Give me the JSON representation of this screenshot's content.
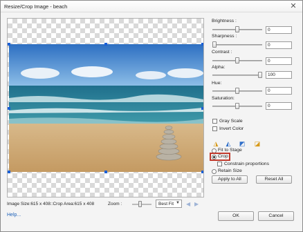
{
  "window": {
    "title": "Resize/Crop Image - beach",
    "close_glyph": "✕"
  },
  "status": {
    "image_size": "Image Size:615 x 408::Crop Area:615 x 408"
  },
  "zoom": {
    "label": "Zoom :",
    "value": "Best Fit",
    "options": [
      "Best Fit"
    ]
  },
  "adjustments": [
    {
      "label": "Brightness :",
      "value": "0",
      "level": 0.5
    },
    {
      "label": "Sharpness :",
      "value": "0",
      "level": 0.0
    },
    {
      "label": "Contrast :",
      "value": "0",
      "level": 0.5
    },
    {
      "label": "Alpha:",
      "value": "100",
      "level": 1.0
    },
    {
      "label": "Hue:",
      "value": "0",
      "level": 0.5
    },
    {
      "label": "Saturation:",
      "value": "0",
      "level": 0.5
    }
  ],
  "options": {
    "gray_scale": "Gray Scale",
    "invert_color": "Invert Color",
    "fit_to_stage": "Fit to Stage",
    "crop": "Crop",
    "constrain_proportions": "Constrain proportions",
    "retain_size": "Retain Size",
    "selected_mode": "Crop"
  },
  "tools": [
    {
      "name": "flip-horizontal-icon",
      "glyph": "◮",
      "color": "#d79a1a"
    },
    {
      "name": "flip-vertical-icon",
      "glyph": "◭",
      "color": "#2f6fc9"
    },
    {
      "name": "rotate-left-icon",
      "glyph": "◩",
      "color": "#2f6fc9"
    },
    {
      "name": "rotate-right-icon",
      "glyph": "◪",
      "color": "#d79a1a"
    }
  ],
  "buttons": {
    "apply_all": "Apply to All",
    "reset_all": "Reset All",
    "ok": "OK",
    "cancel": "Cancel"
  },
  "help": "Help...",
  "colors": {
    "selection_handle": "#1a5fd6",
    "crop_highlight": "#c0392b",
    "link": "#1b5fb8"
  }
}
